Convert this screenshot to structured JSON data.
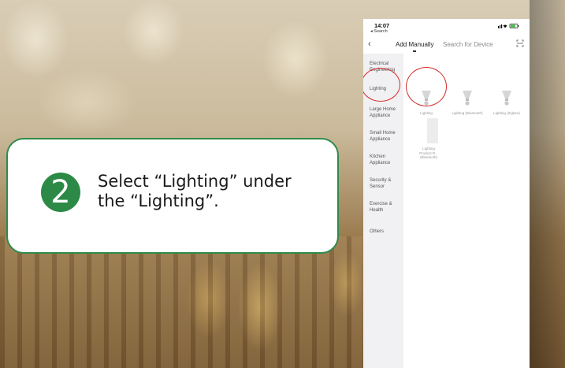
{
  "callout": {
    "step_number": "2",
    "line1": "Select “Lighting” under",
    "line2": "the “Lighting”."
  },
  "status": {
    "time": "14:07",
    "back_app": "◂ Search",
    "icons": "signal wifi battery"
  },
  "nav": {
    "tabs": [
      {
        "label": "Add Manually",
        "selected": true
      },
      {
        "label": "Search for Device",
        "selected": false
      }
    ],
    "back_icon": "chevron-left-icon",
    "scan_icon": "scan-icon"
  },
  "sidebar": {
    "items": [
      {
        "label": "Electrical Engineering",
        "selected": false
      },
      {
        "label": "Lighting",
        "selected": true
      },
      {
        "label": "Large Home Appliance",
        "selected": false
      },
      {
        "label": "Small Home Appliance",
        "selected": false
      },
      {
        "label": "Kitchen Appliance",
        "selected": false
      },
      {
        "label": "Security & Sensor",
        "selected": false
      },
      {
        "label": "Exercise & Health",
        "selected": false
      },
      {
        "label": "Others",
        "selected": false
      }
    ]
  },
  "devices": [
    {
      "label": "Lighting",
      "highlighted": true
    },
    {
      "label": "Lighting (Bluetooth)",
      "highlighted": false
    },
    {
      "label": "Lighting (Zigbee)",
      "highlighted": false
    },
    {
      "label": "Lighting Product R... (Bluetooth)",
      "highlighted": false
    }
  ],
  "colors": {
    "accent_green": "#2e8b4a",
    "highlight_red": "#d72b2b"
  }
}
